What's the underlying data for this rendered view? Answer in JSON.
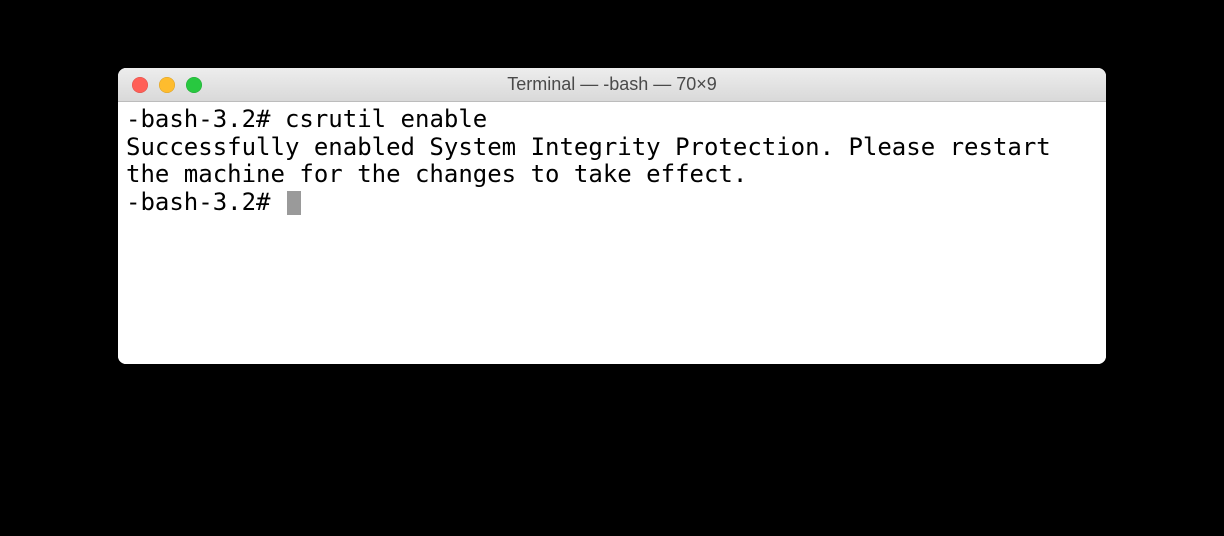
{
  "window": {
    "title": "Terminal — -bash — 70×9"
  },
  "terminal": {
    "line1_prompt": "-bash-3.2# ",
    "line1_command": "csrutil enable",
    "line2": "Successfully enabled System Integrity Protection. Please restart the machine for the changes to take effect.",
    "line3_prompt": "-bash-3.2# "
  }
}
